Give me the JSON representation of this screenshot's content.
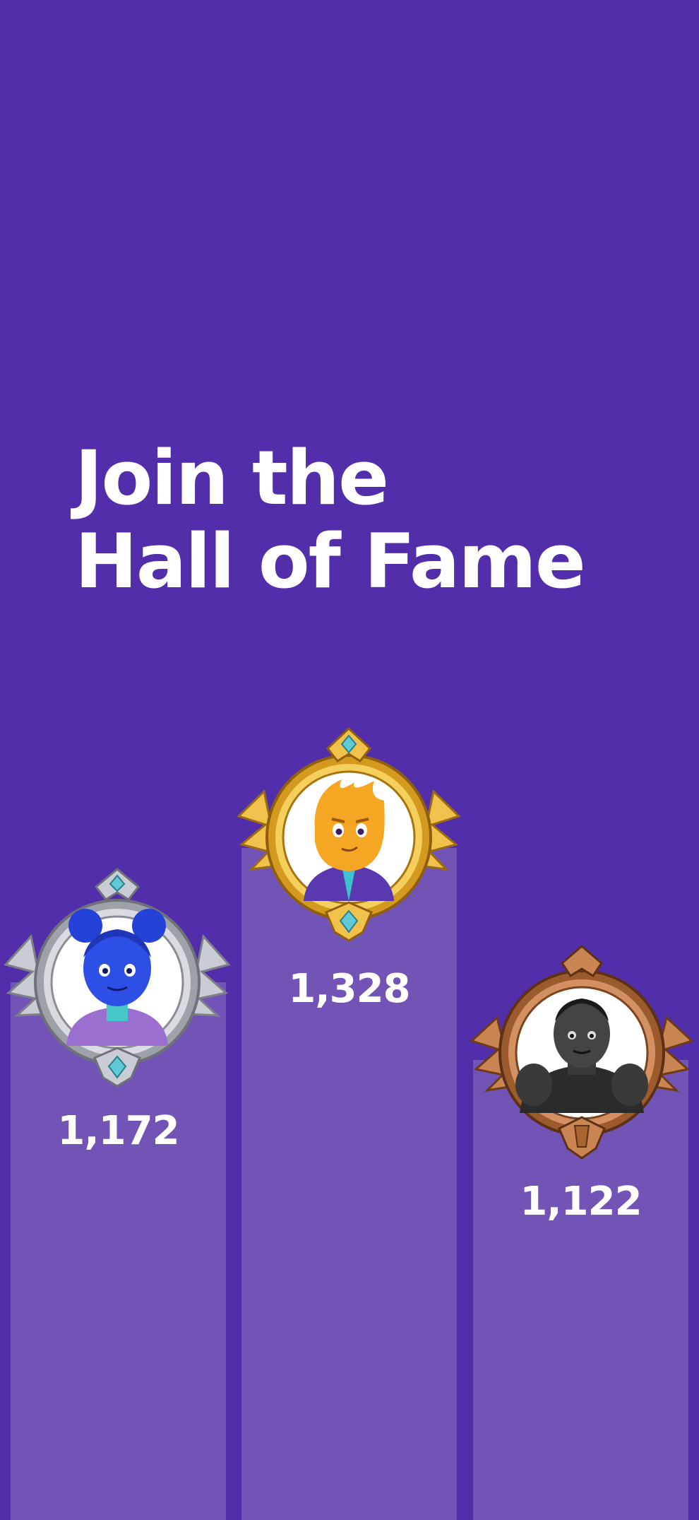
{
  "hero": {
    "title_line1": "Join the",
    "title_line2": "Hall of Fame"
  },
  "leaderboard": [
    {
      "rank": 2,
      "tier": "silver",
      "score": "1,172",
      "avatar": "blue-girl-avatar"
    },
    {
      "rank": 1,
      "tier": "gold",
      "score": "1,328",
      "avatar": "orange-flame-avatar"
    },
    {
      "rank": 3,
      "tier": "bronze",
      "score": "1,122",
      "avatar": "black-muscular-avatar"
    }
  ],
  "colors": {
    "background": "#522eaa",
    "podium": "#7254b6",
    "gold": "#e3a92a",
    "silver": "#b9bcc2",
    "bronze": "#b5713c",
    "gem": "#5fc9d6"
  }
}
